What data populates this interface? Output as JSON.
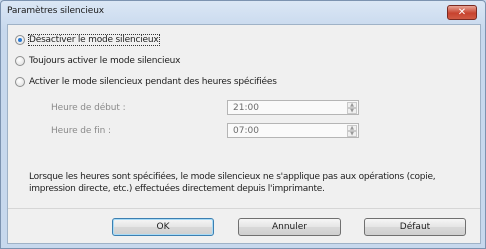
{
  "window": {
    "title": "Paramètres silencieux",
    "close_symbol": "✕"
  },
  "options": [
    {
      "label": "Désactiver le mode silencieux",
      "checked": true
    },
    {
      "label": "Toujours activer le mode silencieux",
      "checked": false
    },
    {
      "label": "Activer le mode silencieux pendant des heures spécifiées",
      "checked": false
    }
  ],
  "hours": {
    "start_label": "Heure de début :",
    "start_value": "21:00",
    "end_label": "Heure de fin :",
    "end_value": "07:00"
  },
  "note": "Lorsque les heures sont spécifiées, le mode silencieux ne s'applique pas aux opérations (copie, impression directe, etc.) effectuées directement depuis l'imprimante.",
  "buttons": {
    "ok": "OK",
    "cancel": "Annuler",
    "default": "Défaut"
  }
}
